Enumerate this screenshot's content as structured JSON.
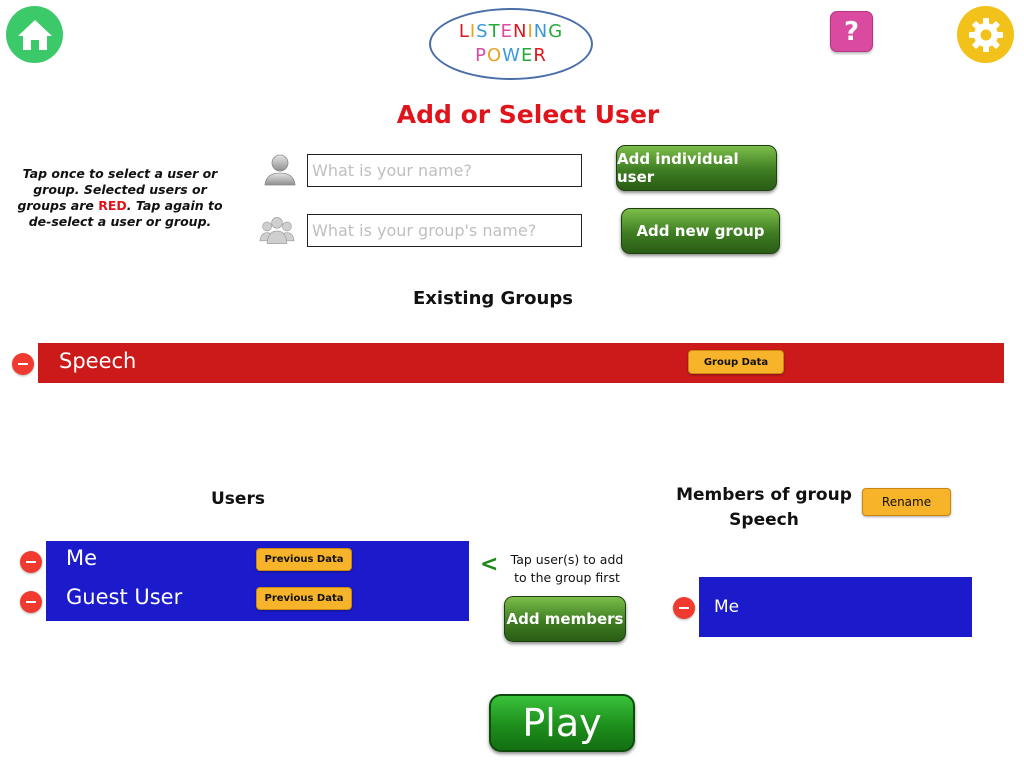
{
  "app": {
    "logo_line1": [
      "L",
      "I",
      "S",
      "T",
      "E",
      "N",
      "I",
      "N",
      "G"
    ],
    "logo_line1_colors": [
      "#e0141b",
      "#e8a320",
      "#3a9ad9",
      "#27a83a",
      "#d94aa0",
      "#e0141b",
      "#e8a320",
      "#3a9ad9",
      "#27a83a"
    ],
    "logo_line2": [
      "P",
      "O",
      "W",
      "E",
      "R"
    ],
    "logo_line2_colors": [
      "#d94aa0",
      "#e8a320",
      "#3a9ad9",
      "#27a83a",
      "#e0141b"
    ],
    "help_label": "?"
  },
  "icons": {
    "home": "home-icon",
    "help": "question-mark-icon",
    "settings": "gear-icon",
    "user": "person-icon",
    "group": "group-icon"
  },
  "page": {
    "title": "Add or Select User",
    "instructions_before": "Tap once to select a user or group. Selected users or groups are ",
    "instructions_red": "RED",
    "instructions_after": ". Tap again to de-select a user or group."
  },
  "form": {
    "name_placeholder": "What is your name?",
    "group_placeholder": "What is your group's name?",
    "add_user_label": "Add individual user",
    "add_group_label": "Add new group"
  },
  "groups": {
    "heading": "Existing Groups",
    "items": [
      {
        "name": "Speech",
        "data_label": "Group Data",
        "selected": true
      }
    ]
  },
  "users": {
    "heading": "Users",
    "items": [
      {
        "name": "Me",
        "data_label": "Previous Data"
      },
      {
        "name": "Guest User",
        "data_label": "Previous Data"
      }
    ]
  },
  "members": {
    "heading_line1": "Members of group",
    "heading_line2": "Speech",
    "rename_label": "Rename",
    "items": [
      {
        "name": "Me"
      }
    ]
  },
  "actions": {
    "arrow": "<",
    "hint_line1": "Tap user(s) to add",
    "hint_line2": "to the group first",
    "add_members_label": "Add members",
    "play_label": "Play"
  },
  "colors": {
    "selected_red": "#cc1a1a",
    "list_blue": "#1b1bcc",
    "title_red": "#e0141b",
    "button_green": "#3e7d22",
    "button_orange": "#f7b329"
  }
}
